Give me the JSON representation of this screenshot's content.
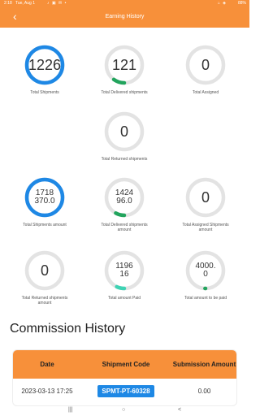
{
  "status_bar": {
    "time": "2:18",
    "date": "Tue, Aug 1",
    "battery": "88%"
  },
  "header": {
    "title": "Earning History",
    "back_icon": "arrow-left-icon"
  },
  "colors": {
    "accent": "#F7903A",
    "ring_track": "#E3E3E3",
    "blue": "#1E88E5",
    "green": "#22A45D",
    "teal": "#3FD3B4"
  },
  "stats": [
    {
      "value": "1226",
      "label": "Total Shipments",
      "progress": 1.0,
      "color": "#1E88E5"
    },
    {
      "value": "121",
      "label": "Total Delivered shipments",
      "progress": 0.1,
      "color": "#22A45D"
    },
    {
      "value": "0",
      "label": "Total Assigned",
      "progress": 0,
      "color": "#22A45D"
    },
    {
      "value": "0",
      "label": "Total Returned shipments",
      "progress": 0,
      "color": "#22A45D"
    },
    {
      "value": "1718\n370.0",
      "label": "Total Shipments amount",
      "progress": 1.0,
      "color": "#1E88E5"
    },
    {
      "value": "1424\n96.0",
      "label": "Total Delivered shipments amount",
      "progress": 0.08,
      "color": "#22A45D"
    },
    {
      "value": "0",
      "label": "Total Assigned Shipments amount",
      "progress": 0,
      "color": "#22A45D"
    },
    {
      "value": "0",
      "label": "Total Returned shipments amount",
      "progress": 0,
      "color": "#22A45D"
    },
    {
      "value": "1196\n16",
      "label": "Total amount Paid",
      "progress": 0.07,
      "color": "#3FD3B4"
    },
    {
      "value": "4000.\n0",
      "label": "Total amount to be paid",
      "progress": 0.005,
      "color": "#22A45D"
    }
  ],
  "commission": {
    "title": "Commission History",
    "headers": [
      "Date",
      "Shipment Code",
      "Submission Amount"
    ],
    "rows": [
      {
        "date": "2023-03-13 17:25",
        "code": "SPMT-PT-60328",
        "amount": "0.00"
      }
    ]
  },
  "nav": {
    "recents": "|||",
    "home": "○",
    "back": "<"
  }
}
